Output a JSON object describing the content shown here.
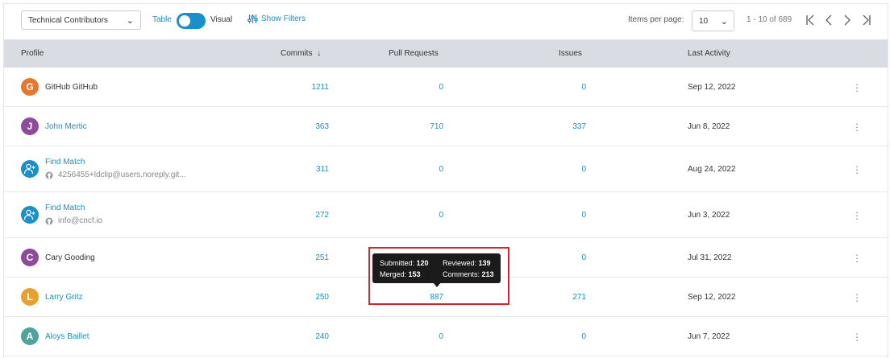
{
  "toolbar": {
    "group_select": "Technical Contributors",
    "table_label": "Table",
    "visual_label": "Visual",
    "show_filters": "Show Filters",
    "items_per_page_label": "Items per page:",
    "items_per_page_value": "10",
    "range_text": "1 - 10 of 689",
    "pager": {
      "first": "|<",
      "prev": "<",
      "next": ">",
      "last": ">|"
    }
  },
  "table": {
    "headers": {
      "profile": "Profile",
      "commits": "Commits",
      "pull_requests": "Pull Requests",
      "issues": "Issues",
      "last_activity": "Last Activity"
    },
    "sort_indicator": "↓",
    "rows": [
      {
        "avatar_letter": "G",
        "avatar_color": "#e8772e",
        "name": "GitHub GitHub",
        "name_link": false,
        "sub": "",
        "commits": "1211",
        "pull_requests": "0",
        "issues": "0",
        "last_activity": "Sep 12, 2022"
      },
      {
        "avatar_letter": "J",
        "avatar_color": "#8e4b9c",
        "name": "John Mertic",
        "name_link": true,
        "sub": "",
        "commits": "363",
        "pull_requests": "710",
        "issues": "337",
        "last_activity": "Jun 8, 2022"
      },
      {
        "avatar_letter": "",
        "avatar_color": "#1a8fc9",
        "name": "Find Match",
        "name_link": true,
        "sub": "4256455+ldclip@users.noreply.git...",
        "commits": "311",
        "pull_requests": "0",
        "issues": "0",
        "last_activity": "Aug 24, 2022"
      },
      {
        "avatar_letter": "",
        "avatar_color": "#1a8fc9",
        "name": "Find Match",
        "name_link": true,
        "sub": "info@cncf.io",
        "commits": "272",
        "pull_requests": "0",
        "issues": "0",
        "last_activity": "Jun 3, 2022"
      },
      {
        "avatar_letter": "C",
        "avatar_color": "#8e4b9c",
        "name": "Cary Gooding",
        "name_link": false,
        "sub": "",
        "commits": "251",
        "pull_requests": "",
        "issues": "0",
        "last_activity": "Jul 31, 2022"
      },
      {
        "avatar_letter": "L",
        "avatar_color": "#e8a030",
        "name": "Larry Gritz",
        "name_link": true,
        "sub": "",
        "commits": "250",
        "pull_requests": "887",
        "issues": "271",
        "last_activity": "Sep 12, 2022"
      },
      {
        "avatar_letter": "A",
        "avatar_color": "#4fa39b",
        "name": "Aloys Baillet",
        "name_link": true,
        "sub": "",
        "commits": "240",
        "pull_requests": "0",
        "issues": "0",
        "last_activity": "Jun 7, 2022"
      }
    ]
  },
  "tooltip": {
    "submitted_label": "Submitted:",
    "submitted_value": "120",
    "reviewed_label": "Reviewed:",
    "reviewed_value": "139",
    "merged_label": "Merged:",
    "merged_value": "153",
    "comments_label": "Comments:",
    "comments_value": "213"
  },
  "colors": {
    "accent": "#1a8fc9",
    "header_bg": "#d9dde3",
    "highlight": "#d6242b"
  }
}
